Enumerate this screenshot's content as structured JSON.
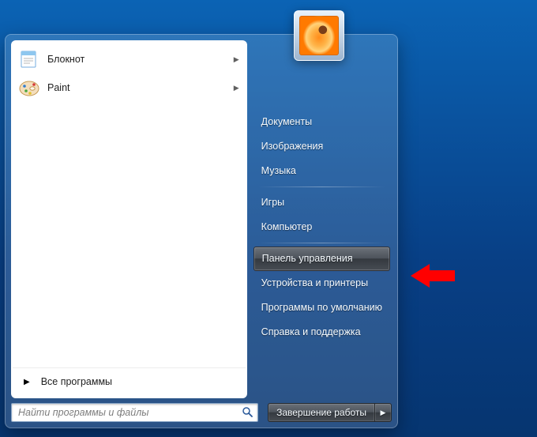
{
  "programs": [
    {
      "label": "Блокнот",
      "icon": "notepad"
    },
    {
      "label": "Paint",
      "icon": "paint"
    }
  ],
  "all_programs_label": "Все программы",
  "search": {
    "placeholder": "Найти программы и файлы"
  },
  "right_items": {
    "documents": "Документы",
    "pictures": "Изображения",
    "music": "Музыка",
    "games": "Игры",
    "computer": "Компьютер",
    "control_panel": "Панель управления",
    "devices_printers": "Устройства и принтеры",
    "default_programs": "Программы по умолчанию",
    "help": "Справка и поддержка"
  },
  "highlighted_item_key": "control_panel",
  "shutdown_label": "Завершение работы"
}
